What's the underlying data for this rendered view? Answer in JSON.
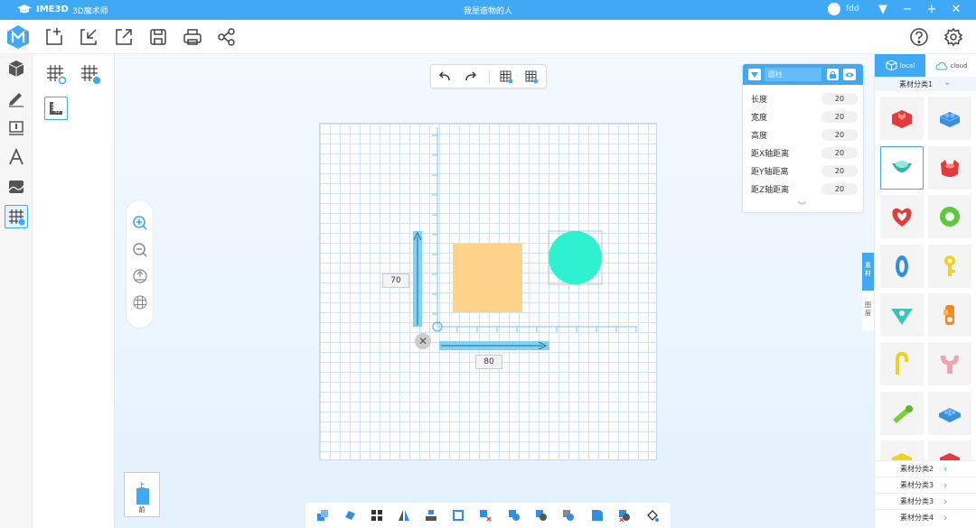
{
  "titlebar": {
    "brand": "IME3D",
    "app_name": "3D魔术师",
    "document_title": "我是造物的人",
    "username": "fdd"
  },
  "toolbar": {
    "icons": [
      "new-file-icon",
      "import-icon",
      "export-icon",
      "save-icon",
      "print-icon",
      "share-icon"
    ],
    "right_icons": [
      "help-icon",
      "settings-icon"
    ]
  },
  "left_tools": [
    "cube-icon",
    "pen-icon",
    "measure-icon",
    "text-icon",
    "image-icon",
    "grid-settings-icon"
  ],
  "sub_tools": [
    "grid-rotate-icon",
    "grid-reset-icon",
    "ruler-icon"
  ],
  "canvas": {
    "dim_height": "70",
    "dim_width": "80"
  },
  "viewcube": {
    "top": "上",
    "front": "前"
  },
  "properties": {
    "title": "圆柱",
    "rows": [
      {
        "label": "长度",
        "value": "20"
      },
      {
        "label": "宽度",
        "value": "20"
      },
      {
        "label": "高度",
        "value": "20"
      },
      {
        "label": "距X轴距离",
        "value": "20"
      },
      {
        "label": "距Y轴距离",
        "value": "20"
      },
      {
        "label": "距Z轴距离",
        "value": "20"
      }
    ]
  },
  "library": {
    "tab_local": "local",
    "tab_cloud": "cloud",
    "current_category": "素材分类1",
    "categories": [
      "素材分类2",
      "素材分类3",
      "素材分类3",
      "素材分类4"
    ],
    "side_tab_material": "素材",
    "side_tab_layer": "图层"
  },
  "colors": {
    "accent": "#3fa9f5",
    "square": "#ffd48a",
    "circle": "#2ef2cf"
  }
}
